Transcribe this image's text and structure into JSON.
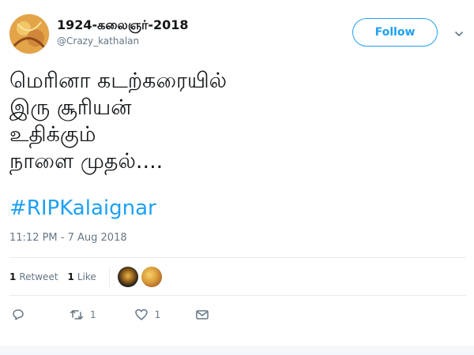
{
  "colors": {
    "accent": "#1da1f2",
    "text_primary": "#14171a",
    "text_secondary": "#657786",
    "divider": "#e6ecf0"
  },
  "header": {
    "display_name": "1924-கலைஞர்-2018",
    "handle": "@Crazy_kathalan",
    "follow_label": "Follow",
    "menu_icon": "chevron-down-icon"
  },
  "tweet": {
    "lines": [
      "மெரினா கடற்கரையில்",
      "இரு சூரியன்",
      "உதிக்கும்",
      "நாளை முதல்...."
    ],
    "hashtag": "#RIPKalaignar",
    "timestamp": "11:12 PM - 7 Aug 2018"
  },
  "stats": {
    "retweets_count": "1",
    "retweets_label": "Retweet",
    "likes_count": "1",
    "likes_label": "Like"
  },
  "actions": {
    "reply_icon": "reply-icon",
    "retweet_icon": "retweet-icon",
    "retweet_count": "1",
    "like_icon": "heart-icon",
    "like_count": "1",
    "message_icon": "envelope-icon"
  }
}
